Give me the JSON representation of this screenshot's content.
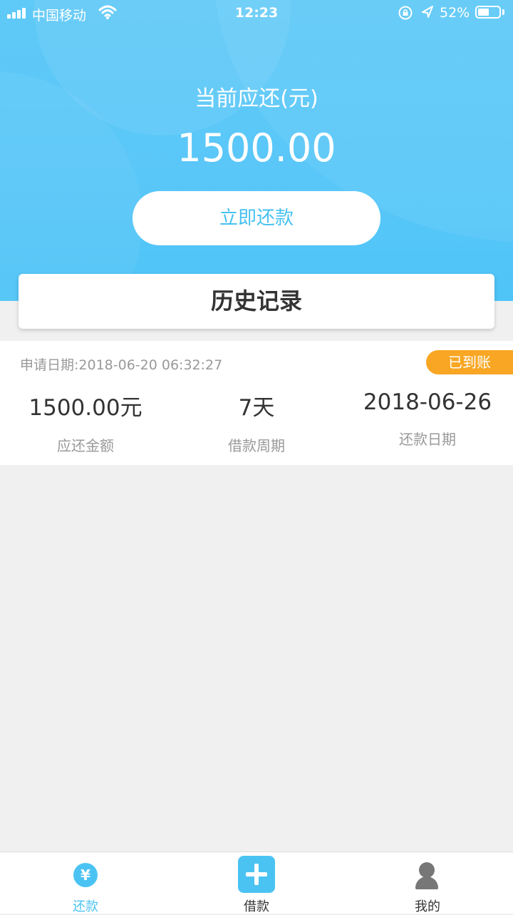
{
  "status_bar": {
    "carrier": "中国移动",
    "time": "12:23",
    "battery_percent": "52%",
    "battery_level": 0.52
  },
  "hero": {
    "label": "当前应还(元)",
    "amount": "1500.00",
    "pay_button": "立即还款"
  },
  "history": {
    "title": "历史记录",
    "records": [
      {
        "apply_date": "申请日期:2018-06-20 06:32:27",
        "status": "已到账",
        "amount_value": "1500.00元",
        "amount_label": "应还金额",
        "period_value": "7天",
        "period_label": "借款周期",
        "due_value": "2018-06-26",
        "due_label": "还款日期"
      }
    ]
  },
  "tabs": [
    {
      "label": "还款",
      "icon": "yen-icon",
      "active": true,
      "color": "#4bc3f2"
    },
    {
      "label": "借款",
      "icon": "plus-icon",
      "active": false,
      "color": "#333333"
    },
    {
      "label": "我的",
      "icon": "user-icon",
      "active": false,
      "color": "#333333"
    }
  ],
  "colors": {
    "accent": "#4bc3f2",
    "badge": "#f8a623"
  }
}
